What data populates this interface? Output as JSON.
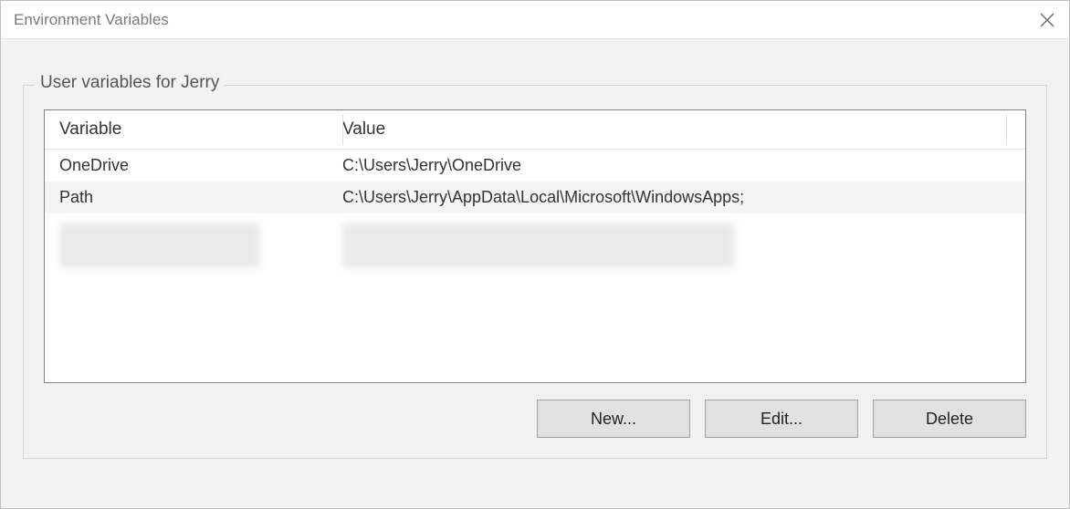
{
  "window": {
    "title": "Environment Variables"
  },
  "group": {
    "legend": "User variables for Jerry"
  },
  "columns": {
    "variable": "Variable",
    "value": "Value"
  },
  "rows": [
    {
      "variable": "OneDrive",
      "value": "C:\\Users\\Jerry\\OneDrive"
    },
    {
      "variable": "Path",
      "value": "C:\\Users\\Jerry\\AppData\\Local\\Microsoft\\WindowsApps;"
    }
  ],
  "buttons": {
    "new": "New...",
    "edit": "Edit...",
    "delete": "Delete"
  }
}
